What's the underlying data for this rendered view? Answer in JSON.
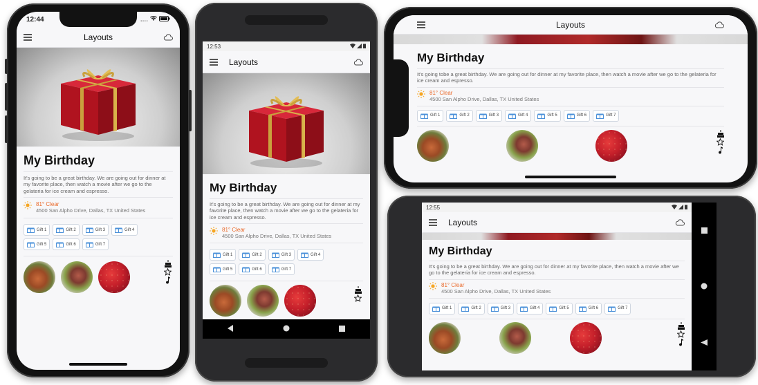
{
  "app": {
    "title": "Layouts",
    "heading": "My Birthday",
    "description": "It's going to be a great birthday. We are going out for dinner at my favorite place, then watch a movie after we go to the gelateria for ice cream and espresso.",
    "description_landscape": "It's going tobe a great birthday. We are going out for dinner at my favorite place, then watch a movie after we go to the gelateria for ice cream and espresso.",
    "weather": {
      "temp": "81° Clear",
      "address": "4500 San Alpho Drive, Dallas, TX United States"
    },
    "gifts": [
      "Gift 1",
      "Gift 2",
      "Gift 3",
      "Gift 4",
      "Gift 5",
      "Gift 6",
      "Gift 7"
    ]
  },
  "status": {
    "iphone_time": "12:44",
    "iphone_dots": "....",
    "android_portrait_time": "12:53",
    "android_landscape_time": "12:55"
  },
  "icons": [
    "menu-icon",
    "cloud-icon",
    "sun-icon",
    "gift-icon",
    "cake-icon",
    "star-icon",
    "music-note-icon",
    "wifi-icon",
    "battery-icon",
    "back-icon",
    "home-icon",
    "recents-icon"
  ],
  "colors": {
    "accent_temp": "#ea6a2b",
    "sun": "#f6a623",
    "gift_icon": "#4a90d9",
    "gift_box": "#c0182a",
    "ribbon": "#d9b24a"
  }
}
